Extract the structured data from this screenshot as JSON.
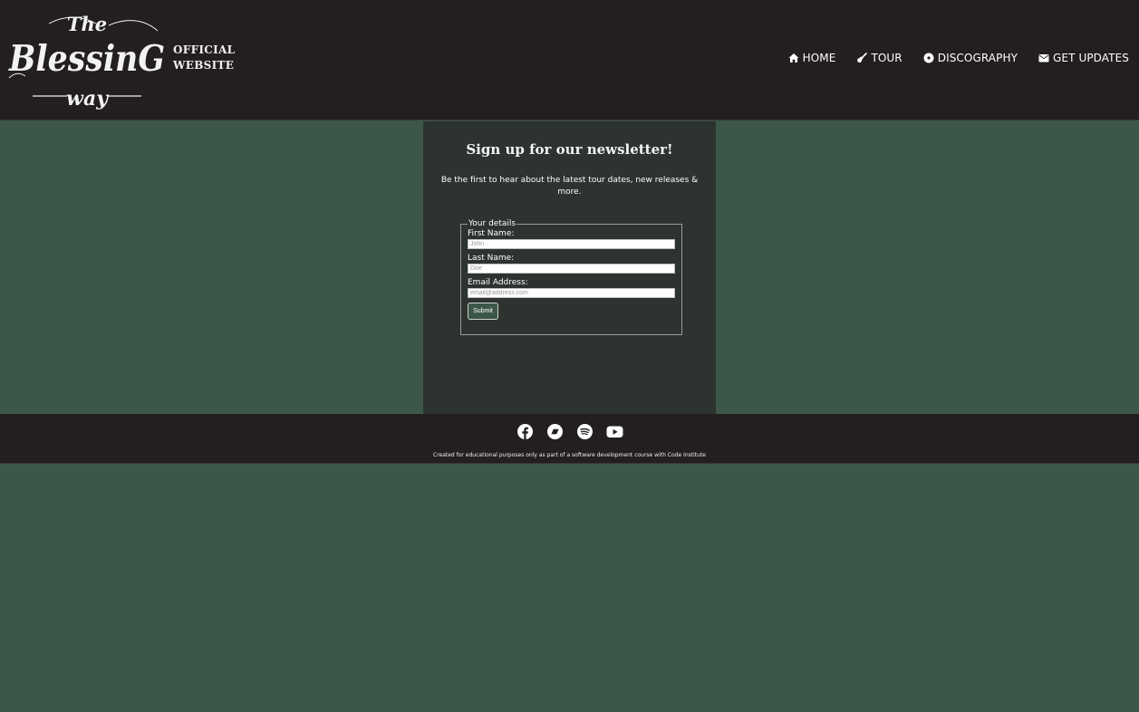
{
  "header": {
    "logo": {
      "line1": "The",
      "line2": "BlessinG",
      "line3": "way",
      "tagline1": "OFFICIAL",
      "tagline2": "WEBSITE"
    },
    "nav": [
      {
        "label": "HOME",
        "icon": "home-icon"
      },
      {
        "label": "TOUR",
        "icon": "guitar-icon"
      },
      {
        "label": "DISCOGRAPHY",
        "icon": "disc-icon"
      },
      {
        "label": "GET UPDATES",
        "icon": "envelope-icon"
      }
    ]
  },
  "newsletter": {
    "title": "Sign up for our newsletter!",
    "text": "Be the first to hear about the latest tour dates, new releases & more.",
    "legend": "Your details",
    "fields": [
      {
        "label": "First Name:",
        "placeholder": "John",
        "value": ""
      },
      {
        "label": "Last Name:",
        "placeholder": "Doe",
        "value": ""
      },
      {
        "label": "Email Address:",
        "placeholder": "email@address.com",
        "value": ""
      }
    ],
    "submit": "Submit"
  },
  "footer": {
    "socials": [
      "facebook-icon",
      "bandcamp-icon",
      "spotify-icon",
      "youtube-icon"
    ],
    "credit": "Created for educational purposes only as part of a software development course with Code Institute"
  },
  "colors": {
    "header_bg": "#231e20",
    "page_bg": "#3c5749",
    "panel_bg": "#2d332f",
    "text": "#ffffff"
  }
}
